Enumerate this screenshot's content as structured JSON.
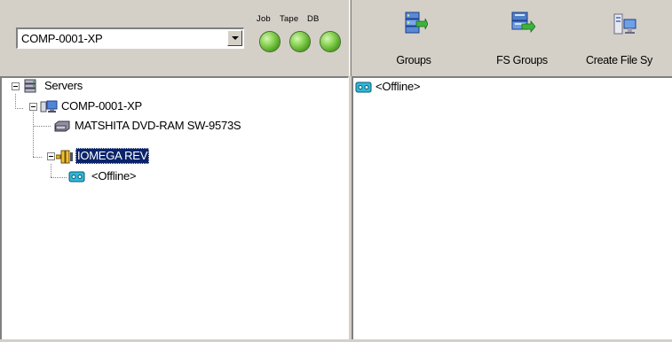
{
  "server_selector": {
    "selected": "COMP-0001-XP"
  },
  "indicators": [
    {
      "label": "Job",
      "status_color": "#5fb82e"
    },
    {
      "label": "Tape",
      "status_color": "#5fb82e"
    },
    {
      "label": "DB",
      "status_color": "#5fb82e"
    }
  ],
  "toolbar": {
    "groups_label": "Groups",
    "fs_groups_label": "FS Groups",
    "create_file_system_label": "Create File Sy"
  },
  "tree": {
    "root": "Servers",
    "server": "COMP-0001-XP",
    "drive_dvd": "MATSHITA DVD-RAM SW-9573S",
    "drive_rev": "IOMEGA REV",
    "media": "<Offline>"
  },
  "list": {
    "item": "<Offline>"
  },
  "colors": {
    "selection": "#0a246a",
    "status_green": "#5fb82e",
    "chrome": "#d4d0c8"
  }
}
